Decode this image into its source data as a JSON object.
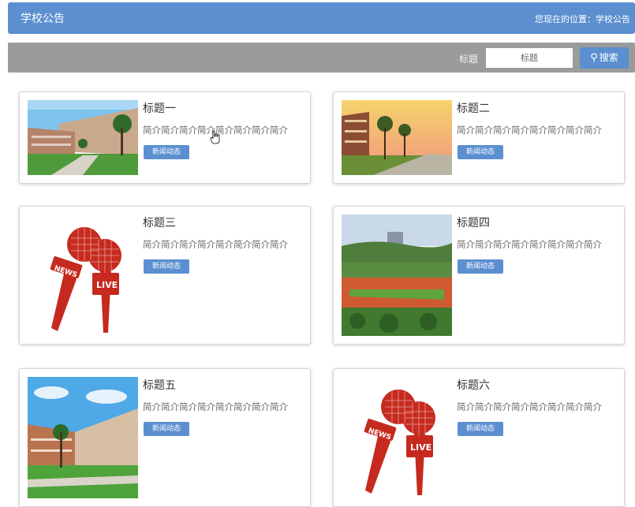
{
  "header": {
    "title": "学校公告",
    "location": "您现在的位置：学校公告"
  },
  "search": {
    "label": "标题",
    "value": "标题",
    "button_label": "搜索"
  },
  "cards": [
    {
      "title": "标题一",
      "desc": "简介简介简介简介简介简介简介简介",
      "tag": "新闻动态"
    },
    {
      "title": "标题二",
      "desc": "简介简介简介简介简介简介简介简介",
      "tag": "新闻动态"
    },
    {
      "title": "标题三",
      "desc": "简介简介简介简介简介简介简介简介",
      "tag": "新闻动态"
    },
    {
      "title": "标题四",
      "desc": "简介简介简介简介简介简介简介简介",
      "tag": "新闻动态"
    },
    {
      "title": "标题五",
      "desc": "简介简介简介简介简介简介简介简介",
      "tag": "新闻动态"
    },
    {
      "title": "标题六",
      "desc": "简介简介简介简介简介简介简介简介",
      "tag": "新闻动态"
    }
  ],
  "colors": {
    "accent": "#5b8fd0",
    "searchbar": "#9a9c9b",
    "mic_red": "#c62a1f"
  }
}
